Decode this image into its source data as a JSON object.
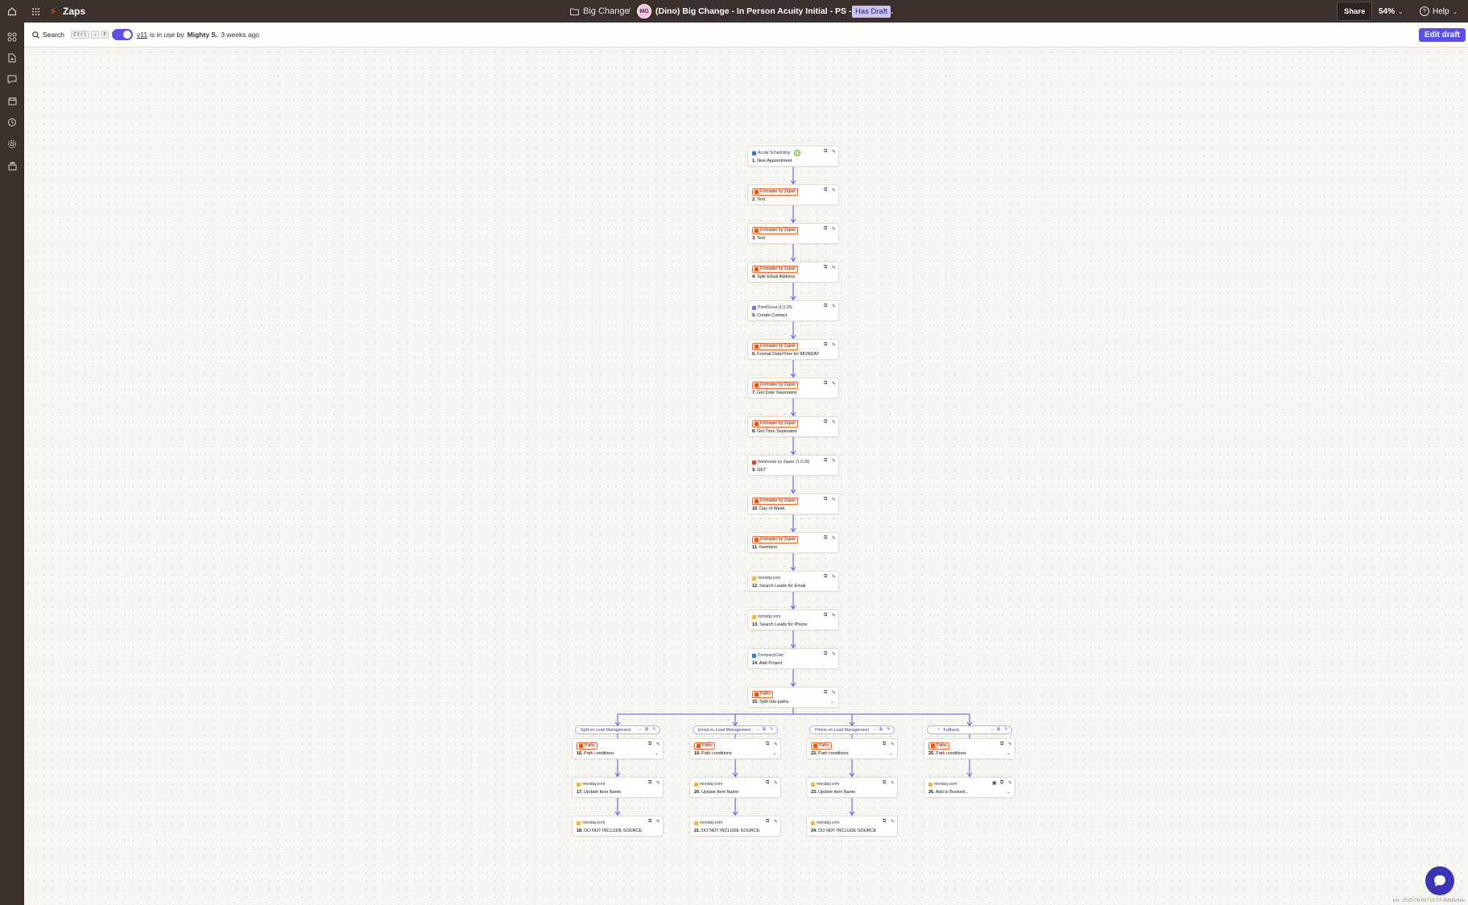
{
  "topbar": {
    "app_name": "Zaps",
    "folder": "Big Change",
    "separator": "/",
    "avatar_initials": "MG",
    "zap_title": "(Dino) Big Change - In Person Acuity Initial - PS - Monday",
    "draft_badge": "Has Draft",
    "share": "Share",
    "zoom": "54%",
    "help": "Help"
  },
  "toolbar": {
    "search_label": "Search",
    "shortcut_keys": [
      "Ctrl",
      "⇧",
      "F"
    ],
    "version": "v11",
    "in_use_prefix": "is in use by",
    "in_use_user": "Mighty S.",
    "in_use_time": "3 weeks ago",
    "edit_draft": "Edit draft"
  },
  "steps": [
    {
      "app": "Acuity Scheduling",
      "num": "1.",
      "title": "New Appointment",
      "tag": false,
      "logo": "#3b6bd9",
      "status": true
    },
    {
      "app": "Formatter by Zapier",
      "num": "2.",
      "title": "Text",
      "tag": true,
      "logo": "#ff4f00"
    },
    {
      "app": "Formatter by Zapier",
      "num": "3.",
      "title": "Text",
      "tag": true,
      "logo": "#ff4f00"
    },
    {
      "app": "Formatter by Zapier",
      "num": "4.",
      "title": "Split Email Address",
      "tag": true,
      "logo": "#ff4f00"
    },
    {
      "app": "PointScout (1.0.18)",
      "num": "5.",
      "title": "Create Contact",
      "tag": false,
      "logo": "#7a6cf0"
    },
    {
      "app": "Formatter by Zapier",
      "num": "6.",
      "title": "Format Date/Time for MONDAY",
      "tag": true,
      "logo": "#ff4f00"
    },
    {
      "app": "Formatter by Zapier",
      "num": "7.",
      "title": "Get Date Seperated",
      "tag": true,
      "logo": "#ff4f00"
    },
    {
      "app": "Formatter by Zapier",
      "num": "8.",
      "title": "Get Time Seperated",
      "tag": true,
      "logo": "#ff4f00"
    },
    {
      "app": "Webhooks by Zapier (1.0.28)",
      "num": "9.",
      "title": "GET",
      "tag": false,
      "logo": "#e0402b"
    },
    {
      "app": "Formatter by Zapier",
      "num": "10.",
      "title": "Day of Week",
      "tag": true,
      "logo": "#ff4f00"
    },
    {
      "app": "Formatter by Zapier",
      "num": "11.",
      "title": "Numbers",
      "tag": true,
      "logo": "#ff4f00"
    },
    {
      "app": "monday.com",
      "num": "12.",
      "title": "Search Leads for Email",
      "tag": false,
      "logo": "#f2b63a"
    },
    {
      "app": "monday.com",
      "num": "13.",
      "title": "Search Leads for Phone",
      "tag": false,
      "logo": "#f2b63a"
    },
    {
      "app": "CompanyCam",
      "num": "14.",
      "title": "Add Project",
      "tag": false,
      "logo": "#2a7de1"
    },
    {
      "app": "Paths",
      "num": "15.",
      "title": "Split into paths",
      "tag": true,
      "logo": "#ff4f00",
      "chevron": true
    }
  ],
  "branches": [
    {
      "label": "Split on Lead Management",
      "steps": [
        {
          "app": "Paths",
          "num": "16.",
          "title": "Path conditions",
          "tag": true,
          "logo": "#ff4f00",
          "chevron": true
        },
        {
          "app": "monday.com",
          "num": "17.",
          "title": "Update Item Name",
          "tag": false,
          "logo": "#f2b63a"
        },
        {
          "app": "monday.com",
          "num": "18.",
          "title": "DO NOT INCLUDE SOURCE",
          "tag": false,
          "logo": "#f2b63a"
        }
      ]
    },
    {
      "label": "Email on Lead Management",
      "steps": [
        {
          "app": "Paths",
          "num": "19.",
          "title": "Path conditions",
          "tag": true,
          "logo": "#ff4f00",
          "chevron": true
        },
        {
          "app": "monday.com",
          "num": "20.",
          "title": "Update Item Name",
          "tag": false,
          "logo": "#f2b63a"
        },
        {
          "app": "monday.com",
          "num": "21.",
          "title": "DO NOT INCLUDE SOURCE",
          "tag": false,
          "logo": "#f2b63a"
        }
      ]
    },
    {
      "label": "Phone on Lead Management",
      "steps": [
        {
          "app": "Paths",
          "num": "22.",
          "title": "Path conditions",
          "tag": true,
          "logo": "#ff4f00",
          "chevron": true
        },
        {
          "app": "monday.com",
          "num": "23.",
          "title": "Update Item Name",
          "tag": false,
          "logo": "#f2b63a"
        },
        {
          "app": "monday.com",
          "num": "24.",
          "title": "DO NOT INCLUDE SOURCE",
          "tag": false,
          "logo": "#f2b63a"
        }
      ]
    },
    {
      "label": "Fallback",
      "fallback": true,
      "steps": [
        {
          "app": "Paths",
          "num": "25.",
          "title": "Path conditions",
          "tag": true,
          "logo": "#ff4f00",
          "chevron": true
        },
        {
          "app": "monday.com",
          "num": "26.",
          "title": "Add to Booked...",
          "tag": false,
          "logo": "#f2b63a",
          "chevron": true,
          "extra_icon": true
        }
      ]
    }
  ],
  "footer": {
    "version_string": "ver. 2025-09-08T15:07-4b6de8ee"
  },
  "colors": {
    "accent": "#5b4ef0",
    "brand_orange": "#ff4f00",
    "connector": "#5b4ef0",
    "chrome_dark": "#3a312c"
  }
}
